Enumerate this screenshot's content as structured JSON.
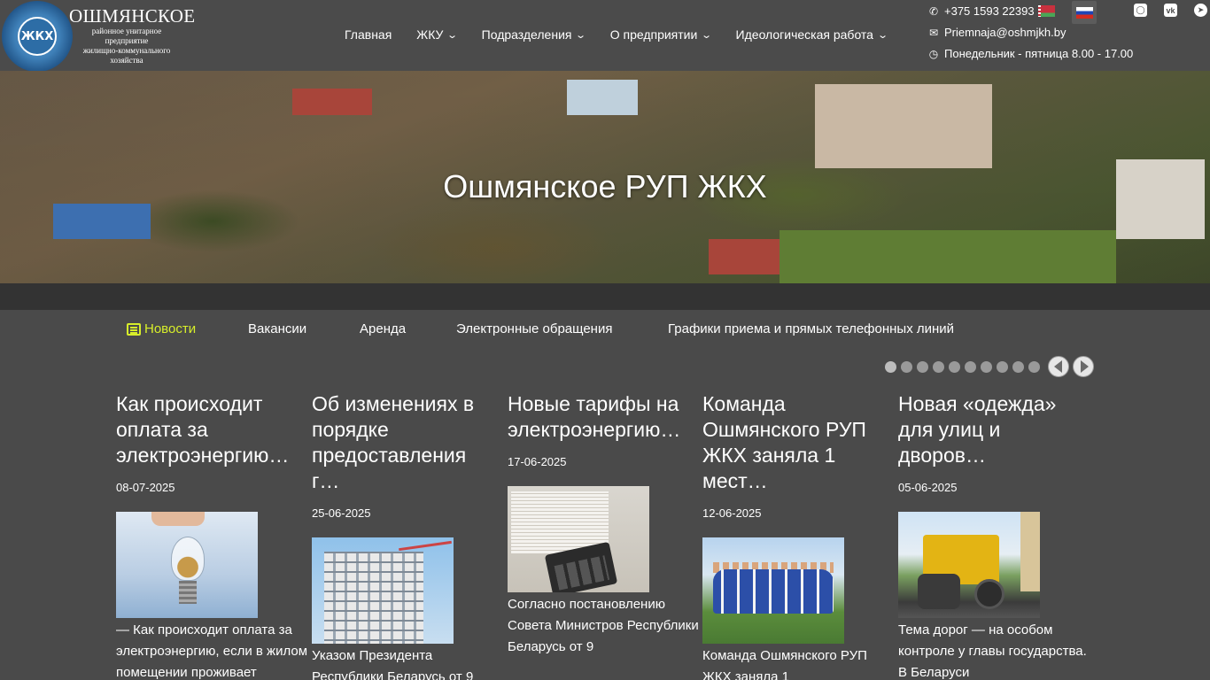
{
  "brand": {
    "title": "ОШМЯНСКОЕ",
    "subtitle_lines": [
      "районное унитарное",
      "предприятие",
      "жилищно-коммунального",
      "хозяйства"
    ],
    "emblem_text": "ЖКХ"
  },
  "nav": {
    "items": [
      {
        "label": "Главная",
        "dropdown": false
      },
      {
        "label": "ЖКУ",
        "dropdown": true
      },
      {
        "label": "Подразделения",
        "dropdown": true
      },
      {
        "label": "О предприятии",
        "dropdown": true
      },
      {
        "label": "Идеологическая работа",
        "dropdown": true
      }
    ]
  },
  "contacts": {
    "phone": "+375 1593 22393",
    "email": "Priemnaja@oshmjkh.by",
    "hours_label": "Понедельник - пятница 8.00 - 17.00"
  },
  "social": [
    "instagram-icon",
    "vk-icon",
    "telegram-icon"
  ],
  "hero": {
    "title": "Ошмянское РУП ЖКХ"
  },
  "tabs": [
    {
      "label": "Новости",
      "active": true
    },
    {
      "label": "Вакансии",
      "active": false
    },
    {
      "label": "Аренда",
      "active": false
    },
    {
      "label": "Электронные обращения",
      "active": false
    },
    {
      "label": "Графики приема и прямых телефонных линий",
      "active": false
    }
  ],
  "slider": {
    "dot_count": 10,
    "active_dot": 1
  },
  "news": [
    {
      "title": "Как происходит оплата за электроэнергию…",
      "date": "08-07-2025",
      "excerpt": "— Как происходит оплата за электроэнергию, если в жилом помещении проживает несколько собственников?"
    },
    {
      "title": "Об изменениях в порядке предоставления г…",
      "date": "25-06-2025",
      "excerpt": "Указом Президента Республики Беларусь от 9"
    },
    {
      "title": "Новые тарифы на электроэнергию…",
      "date": "17-06-2025",
      "excerpt": "Согласно постановлению Совета Министров Республики Беларусь от 9"
    },
    {
      "title": "Команда Ошмянского РУП ЖКХ заняла 1 мест…",
      "date": "12-06-2025",
      "excerpt": "Команда Ошмянского РУП ЖКХ заняла 1"
    },
    {
      "title": "Новая «одежда» для улиц и дворов…",
      "date": "05-06-2025",
      "excerpt": "Тема дорог — на особом контроле у главы государства. В Беларуси"
    }
  ],
  "colors": {
    "header_bg": "#4b4b4b",
    "page_bg": "#4a4a4a",
    "band_bg": "#333333",
    "active_tab": "#d7ee2a"
  }
}
